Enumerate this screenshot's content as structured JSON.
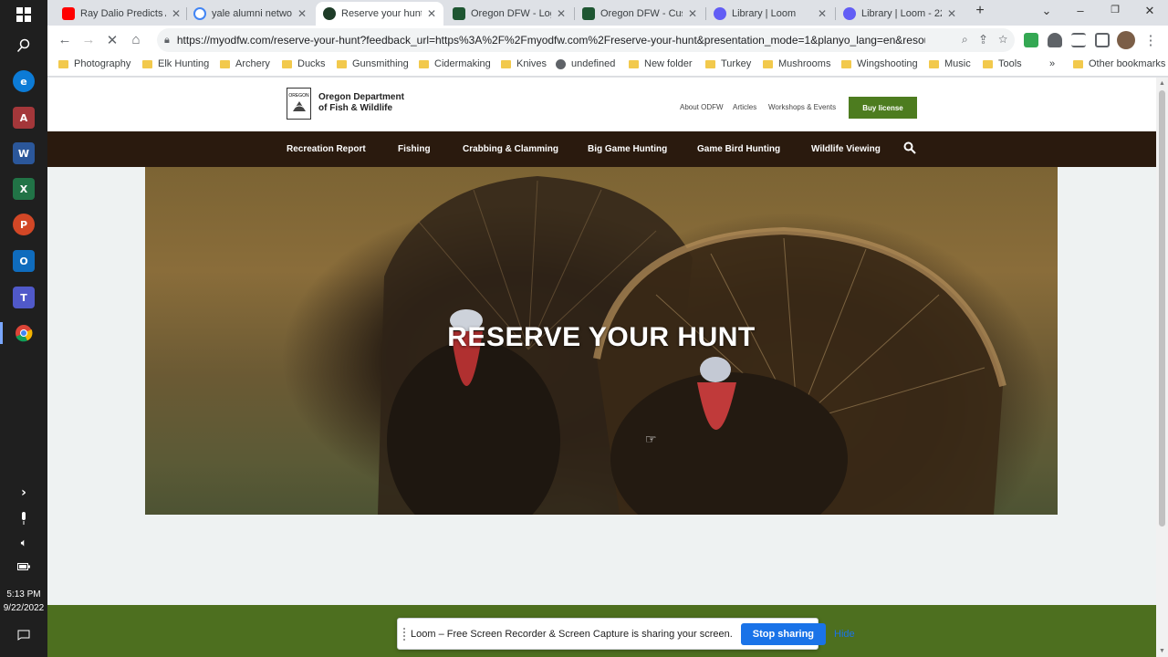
{
  "taskbar": {
    "time": "5:13 PM",
    "date": "9/22/2022"
  },
  "tabs": [
    {
      "title": "Ray Dalio Predicts A",
      "color": "#ff0000"
    },
    {
      "title": "yale alumni network",
      "color": "#4285f4"
    },
    {
      "title": "Reserve your hunt |",
      "color": "#1e3c28"
    },
    {
      "title": "Oregon DFW - Logi",
      "color": "#1e5632"
    },
    {
      "title": "Oregon DFW - Cust",
      "color": "#1e5632"
    },
    {
      "title": "Library | Loom",
      "color": "#625df5"
    },
    {
      "title": "Library | Loom - 22",
      "color": "#625df5"
    }
  ],
  "browser": {
    "url": "https://myodfw.com/reserve-your-hunt?feedback_url=https%3A%2F%2Fmyodfw.com%2Freserve-your-hunt&presentation_mode=1&planyo_lang=en&resourc...",
    "new_tab": "+"
  },
  "bookmarks": [
    "Photography",
    "Elk Hunting",
    "Archery",
    "Ducks",
    "Gunsmithing",
    "Cidermaking",
    "Knives",
    "undefined",
    "New folder",
    "Turkey",
    "Mushrooms",
    "Wingshooting",
    "Music",
    "Tools"
  ],
  "bookmarks_more": "»",
  "bookmarks_other": "Other bookmarks",
  "site": {
    "logo_line1": "Oregon Department",
    "logo_line2": "of Fish & Wildlife",
    "logo_badge_top": "OREGON",
    "utility_links": [
      "About ODFW",
      "Articles",
      "Workshops & Events"
    ],
    "buy_license": "Buy license",
    "nav": [
      "Recreation Report",
      "Fishing",
      "Crabbing & Clamming",
      "Big Game Hunting",
      "Game Bird Hunting",
      "Wildlife Viewing"
    ],
    "hero_title": "RESERVE YOUR HUNT"
  },
  "loom": {
    "message": "Loom – Free Screen Recorder & Screen Capture is sharing your screen.",
    "stop_label": "Stop sharing",
    "hide_label": "Hide"
  }
}
